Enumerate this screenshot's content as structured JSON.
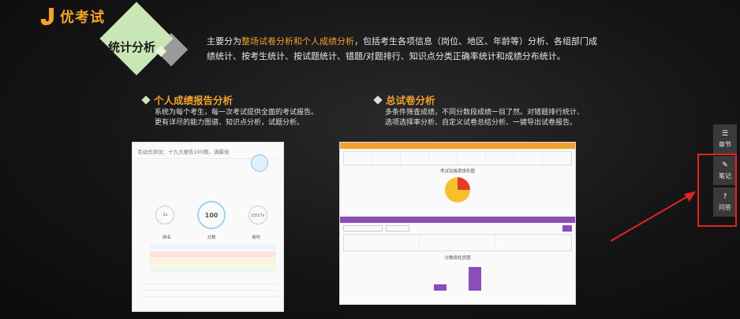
{
  "logo": {
    "text": "优考试"
  },
  "header": {
    "section_title": "统计分析",
    "intro_prefix": "主要分为",
    "intro_highlight": "整场试卷分析和个人成绩分析",
    "intro_suffix": "，包括考生各项信息（岗位、地区、年龄等）分析、各组部门成绩统计、按考生统计、按试题统计、错题/对题排行、知识点分类正确率统计和成绩分布统计。"
  },
  "personal": {
    "title": "个人成绩报告分析",
    "desc_line1": "系统为每个考生，每一次考试提供全面的考试报告。",
    "desc_line2": "更有详尽的能力图谱、知识点分析，试题分析。",
    "card_title": "互动式测试：十九大报告100题，满最佳",
    "stat_1": "1s",
    "stat_2": "100",
    "stat_3": "2分17s",
    "label_rank": "排名",
    "label_score": "分数",
    "label_time": "用时"
  },
  "overall": {
    "title": "总试卷分析",
    "desc_line1": "多条件筛查成绩，不同分数段成绩一目了然。对错题排行统计、",
    "desc_line2": "选项选择率分析、自定义试卷总结分析、一键导出试卷报告。",
    "chart_title": "考试及格率饼形图",
    "bar_title": "分数段柱状图"
  },
  "side_panel": {
    "chapters": "章节",
    "notes": "笔记",
    "qa": "问答"
  },
  "colors": {
    "accent": "#f2a22c",
    "panel": "#3a3a3a",
    "highlight_box": "#e02424",
    "diamond_green": "#c9e7b6"
  },
  "icons": [
    "list-icon",
    "pencil-icon",
    "question-icon"
  ]
}
